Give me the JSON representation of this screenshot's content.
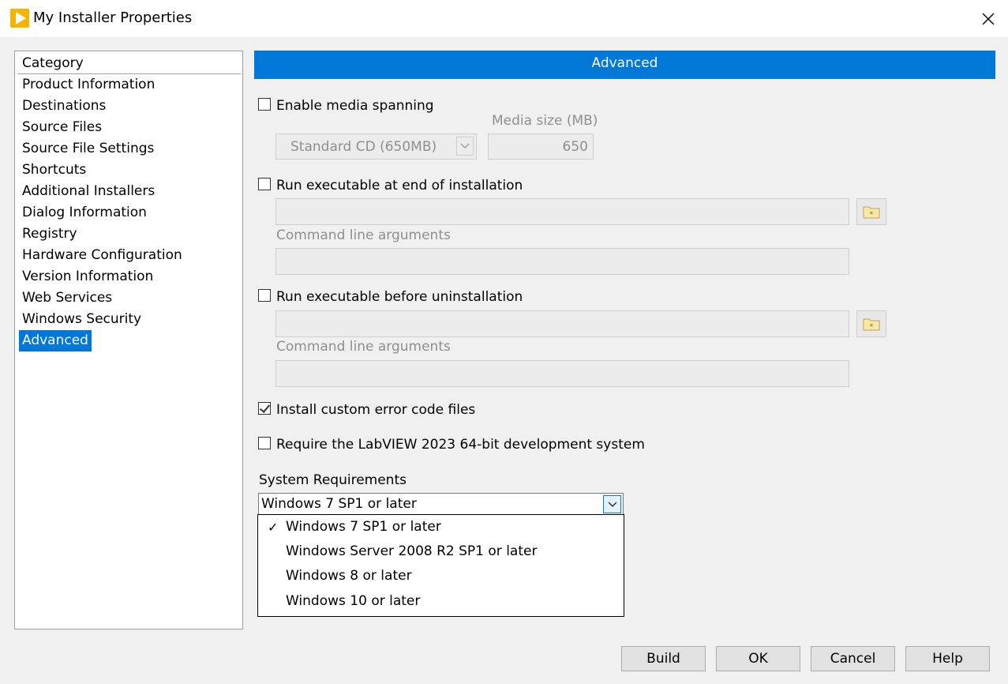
{
  "window": {
    "title": "My Installer Properties",
    "icon": "labview-play-icon",
    "close_icon": "close-icon"
  },
  "category": {
    "header": "Category",
    "items": [
      {
        "label": "Product Information",
        "selected": false
      },
      {
        "label": "Destinations",
        "selected": false
      },
      {
        "label": "Source Files",
        "selected": false
      },
      {
        "label": "Source File Settings",
        "selected": false
      },
      {
        "label": "Shortcuts",
        "selected": false
      },
      {
        "label": "Additional Installers",
        "selected": false
      },
      {
        "label": "Dialog Information",
        "selected": false
      },
      {
        "label": "Registry",
        "selected": false
      },
      {
        "label": "Hardware Configuration",
        "selected": false
      },
      {
        "label": "Version Information",
        "selected": false
      },
      {
        "label": "Web Services",
        "selected": false
      },
      {
        "label": "Windows Security",
        "selected": false
      },
      {
        "label": "Advanced",
        "selected": true
      }
    ]
  },
  "advanced": {
    "header": "Advanced",
    "media_spanning": {
      "label": "Enable media spanning",
      "checked": false,
      "media_type": "Standard CD (650MB)",
      "media_size_label": "Media size (MB)",
      "media_size_value": "650"
    },
    "run_at_end": {
      "label": "Run executable at end of installation",
      "checked": false,
      "path_value": "",
      "args_label": "Command line arguments",
      "args_value": ""
    },
    "run_before_uninstall": {
      "label": "Run executable before uninstallation",
      "checked": false,
      "path_value": "",
      "args_label": "Command line arguments",
      "args_value": ""
    },
    "custom_error_codes": {
      "label": "Install custom error code files",
      "checked": true
    },
    "require_labview": {
      "label": "Require the LabVIEW 2023 64-bit development system",
      "checked": false
    },
    "system_requirements": {
      "label": "System Requirements",
      "selected": "Windows 7 SP1 or later",
      "check_glyph": "✓",
      "options": [
        "Windows 7 SP1 or later",
        "Windows Server 2008 R2 SP1 or later",
        "Windows 8 or later",
        "Windows 10 or later"
      ]
    }
  },
  "buttons": {
    "build": "Build",
    "ok": "OK",
    "cancel": "Cancel",
    "help": "Help"
  },
  "colors": {
    "accent": "#0078d7",
    "app_icon": "#f5b400"
  }
}
